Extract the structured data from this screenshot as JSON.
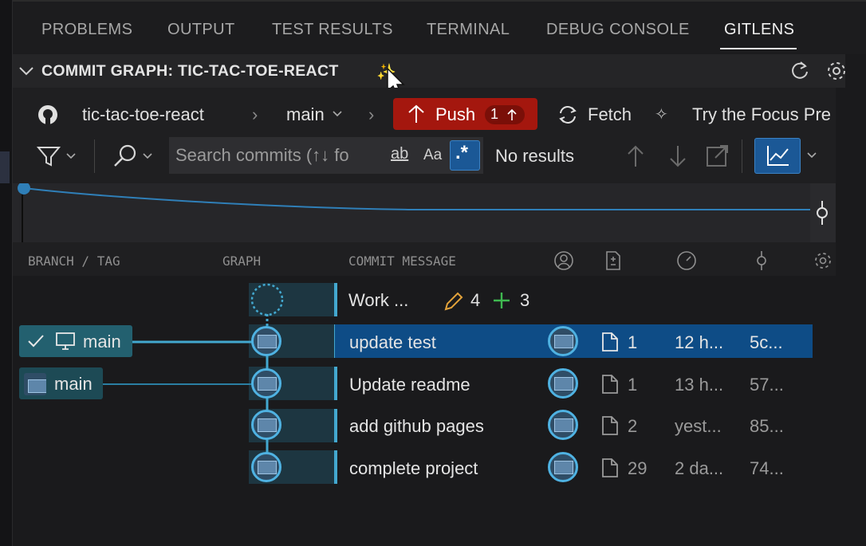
{
  "tabs": [
    {
      "label": "PROBLEMS"
    },
    {
      "label": "OUTPUT"
    },
    {
      "label": "TEST RESULTS"
    },
    {
      "label": "TERMINAL"
    },
    {
      "label": "DEBUG CONSOLE"
    },
    {
      "label": "GITLENS",
      "active": true
    }
  ],
  "view": {
    "title": "COMMIT GRAPH: TIC-TAC-TOE-REACT",
    "sparkle": "✨"
  },
  "toolbar": {
    "repo": "tic-tac-toe-react",
    "branch": "main",
    "push_label": "Push",
    "push_count": "1",
    "fetch_label": "Fetch",
    "focus_label": "Try the Focus Pre",
    "search_placeholder": "Search commits (↑↓ fo",
    "match_word_label": "ab",
    "match_case_label": "Aa",
    "regex_label": ".*",
    "search_status": "No results"
  },
  "columns": {
    "branch": "BRANCH / TAG",
    "graph": "GRAPH",
    "message": "COMMIT MESSAGE"
  },
  "wip": {
    "label": "Work ...",
    "changed": "4",
    "added": "3"
  },
  "commits": [
    {
      "message": "update test",
      "files": "1",
      "time": "12 h...",
      "sha": "5c...",
      "selected": true
    },
    {
      "message": "Update readme",
      "files": "1",
      "time": "13 h...",
      "sha": "57..."
    },
    {
      "message": "add github pages",
      "files": "2",
      "time": "yest...",
      "sha": "85..."
    },
    {
      "message": "complete project",
      "files": "29",
      "time": "2 da...",
      "sha": "74..."
    }
  ],
  "branches": [
    {
      "label": "main",
      "current": true
    },
    {
      "label": "main",
      "remote": true
    }
  ],
  "colors": {
    "accent": "#43a8cf",
    "push": "#a4170e",
    "selected": "#0e4c86",
    "edit_icon": "#e3a23a",
    "add_icon": "#3fb950"
  }
}
